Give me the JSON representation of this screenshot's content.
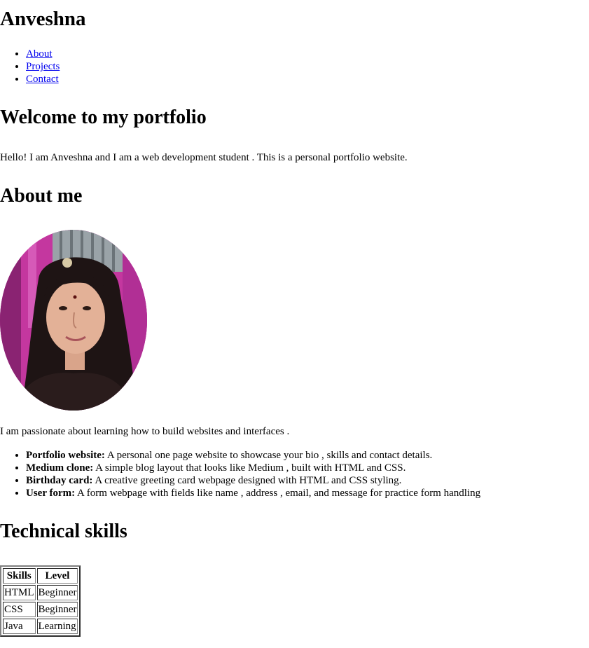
{
  "header": {
    "title": "Anveshna",
    "nav": [
      {
        "label": "About"
      },
      {
        "label": "Projects"
      },
      {
        "label": "Contact"
      }
    ]
  },
  "welcome": {
    "heading": "Welcome to my portfolio",
    "text": "Hello! I am Anveshna and I am a web development student . This is a personal portfolio website."
  },
  "about": {
    "heading": "About me",
    "photo_icon": "profile-photo",
    "text": "I am passionate about learning how to build websites and interfaces .",
    "projects": [
      {
        "title": "Portfolio website:",
        "description": " A personal one page website to showcase your bio , skills and contact details."
      },
      {
        "title": "Medium clone:",
        "description": " A simple blog layout that looks like Medium , built with HTML and CSS."
      },
      {
        "title": "Birthday card:",
        "description": " A creative greeting card webpage designed with HTML and CSS styling."
      },
      {
        "title": "User form:",
        "description": " A form webpage with fields like name , address , email, and message for practice form handling"
      }
    ]
  },
  "skills": {
    "heading": "Technical skills",
    "columns": [
      "Skills",
      "Level"
    ],
    "rows": [
      [
        "HTML",
        "Beginner"
      ],
      [
        "CSS",
        "Beginner"
      ],
      [
        "Java",
        "Learning"
      ]
    ]
  },
  "colors": {
    "link": "#0000ee",
    "text": "#000000",
    "background": "#ffffff"
  }
}
